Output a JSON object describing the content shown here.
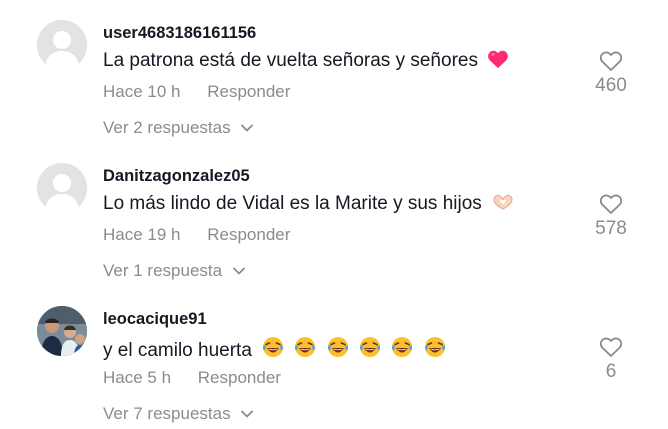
{
  "comments": [
    {
      "username": "user4683186161156",
      "text": "La patrona está de vuelta señoras y señores",
      "emoji": "pink-heart",
      "time": "Hace 10 h",
      "reply_label": "Responder",
      "replies_label": "Ver 2 respuestas",
      "likes": "460"
    },
    {
      "username": "Danitzagonzalez05",
      "text": "Lo más lindo de Vidal es la Marite y sus hijos",
      "emoji": "heart-hands",
      "time": "Hace 19 h",
      "reply_label": "Responder",
      "replies_label": "Ver 1 respuesta",
      "likes": "578"
    },
    {
      "username": "leocacique91",
      "text": "y el camilo huerta",
      "emoji": "laughing-crying x6",
      "time": "Hace 5 h",
      "reply_label": "Responder",
      "replies_label": "Ver 7 respuestas",
      "likes": "6"
    }
  ],
  "colors": {
    "primary_text": "#161823",
    "secondary_text": "#8a8b91",
    "pink_heart": "#fe2c6e",
    "default_avatar": "#e3e3e4"
  }
}
